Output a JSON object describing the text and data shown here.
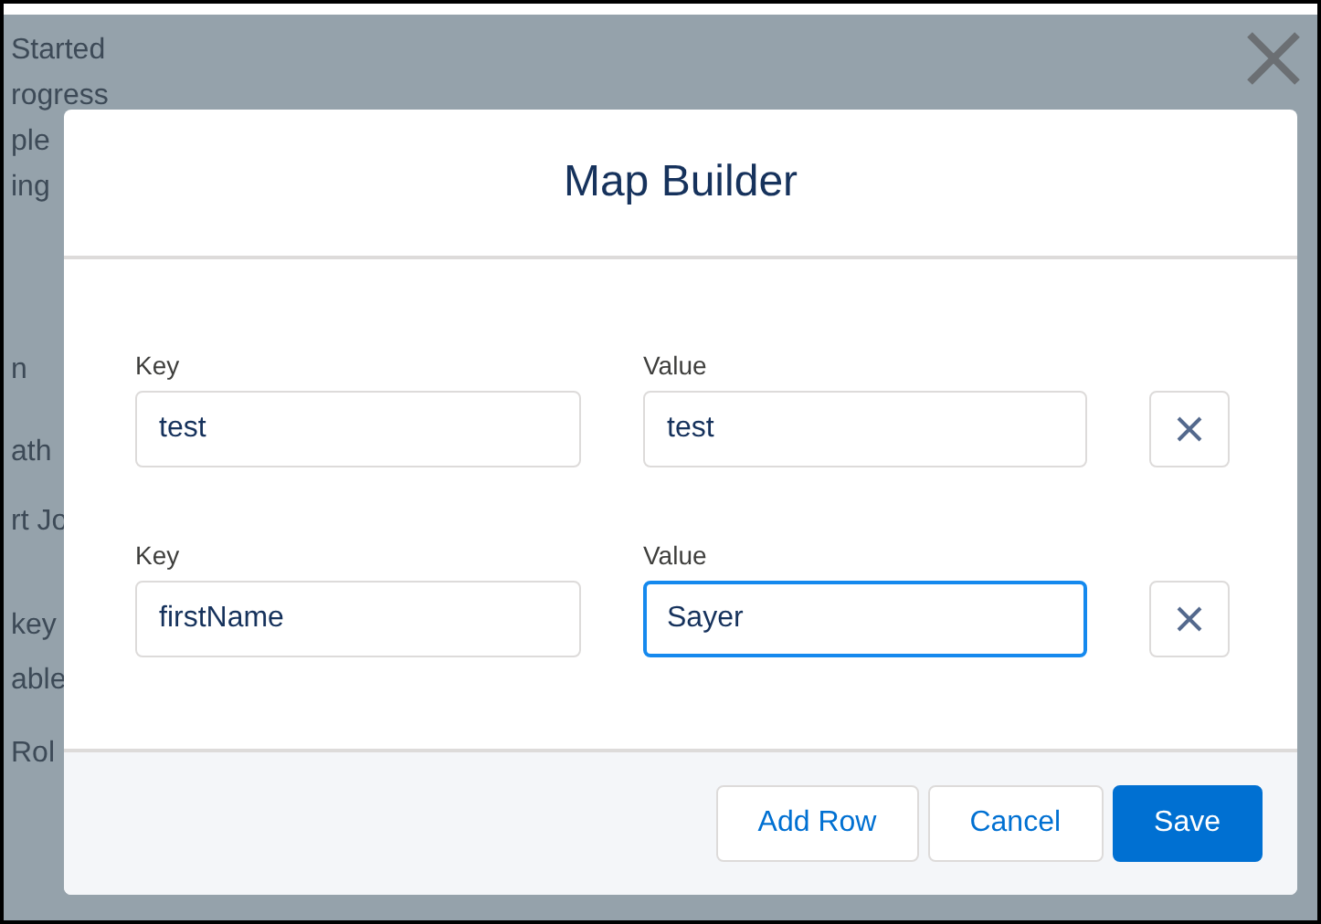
{
  "background_fragments": [
    "Started",
    "rogress",
    "ple",
    "ing",
    "n",
    "ath",
    "rt Jo",
    "key",
    "able",
    "Rol"
  ],
  "modal": {
    "title": "Map Builder",
    "rows": [
      {
        "key_label": "Key",
        "key": "test",
        "value_label": "Value",
        "value": "test",
        "focused": false
      },
      {
        "key_label": "Key",
        "key": "firstName",
        "value_label": "Value",
        "value": "Sayer",
        "focused": true
      }
    ],
    "buttons": [
      {
        "label": "Add Row",
        "kind": "neutral"
      },
      {
        "label": "Cancel",
        "kind": "neutral"
      },
      {
        "label": "Save",
        "kind": "brand"
      }
    ]
  }
}
